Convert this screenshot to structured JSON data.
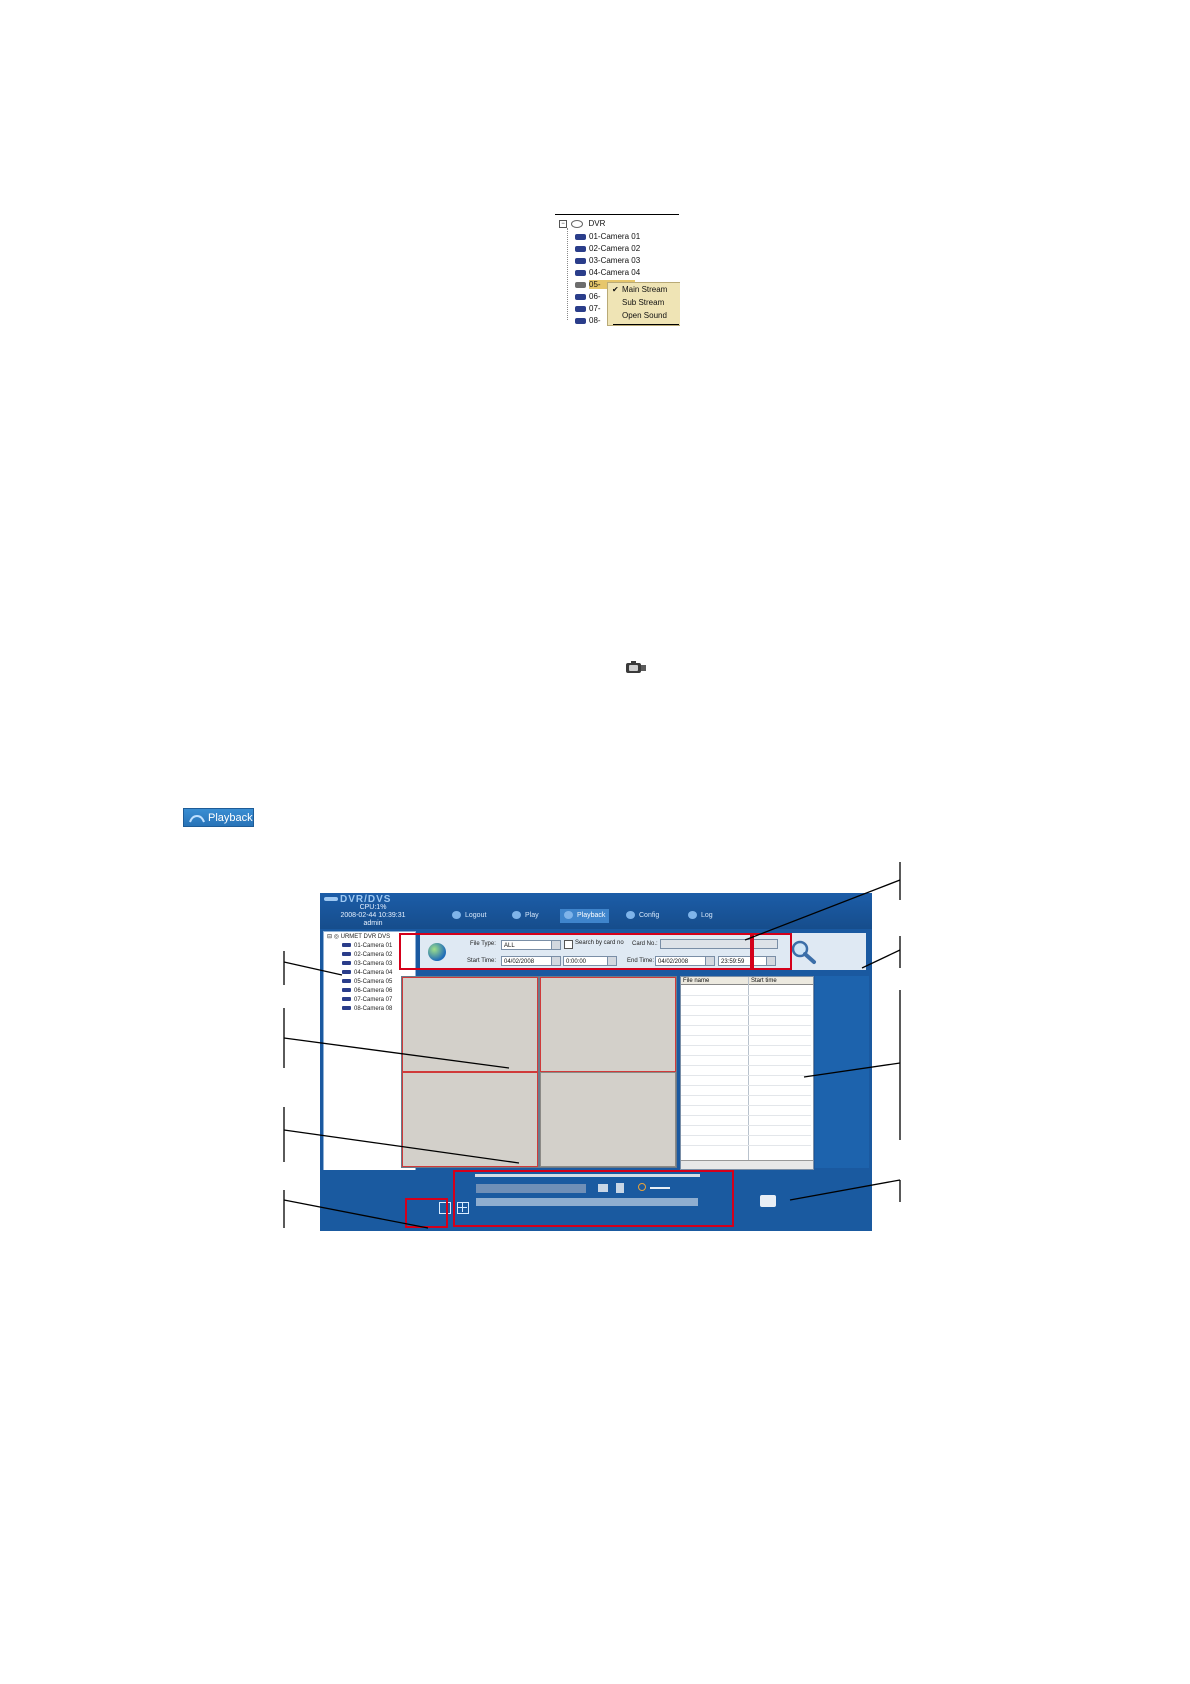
{
  "tree_menu_figure": {
    "root": "DVR",
    "cameras": [
      "01-Camera 01",
      "02-Camera 02",
      "03-Camera 03",
      "04-Camera 04",
      "05-",
      "06-",
      "07-",
      "08-"
    ],
    "context_menu": {
      "items": [
        "Main Stream",
        "Sub Stream",
        "Open Sound"
      ],
      "checked": "Main Stream",
      "check_mark": "✔"
    }
  },
  "playback_button": {
    "label": "Playback"
  },
  "client_window": {
    "brand": "DVR/DVS",
    "cpu": "CPU:1%",
    "datetime": "2008-02-44 10:39:31",
    "user": "admin",
    "tabs": [
      "Logout",
      "Play",
      "Playback",
      "Config",
      "Log"
    ],
    "active_tab": "Playback",
    "tree": {
      "root": "URMET DVR DVS",
      "cameras": [
        "01-Camera 01",
        "02-Camera 02",
        "03-Camera 03",
        "04-Camera 04",
        "05-Camera 05",
        "06-Camera 06",
        "07-Camera 07",
        "08-Camera 08"
      ]
    },
    "search": {
      "file_type_label": "File Type:",
      "file_type_value": "ALL",
      "search_by_card_label": "Search by card no",
      "card_no_label": "Card No.:",
      "start_time_label": "Start Time:",
      "start_date": "04/02/2008",
      "start_time": "0:00:00",
      "end_time_label": "End Time:",
      "end_date": "04/02/2008",
      "end_time": "23:59:59"
    },
    "file_list": {
      "columns": [
        "File name",
        "Start time"
      ]
    }
  },
  "colors": {
    "window_blue": "#1a59a0",
    "highlight_red": "#d4001a",
    "menu_bg": "#efe4b5"
  }
}
